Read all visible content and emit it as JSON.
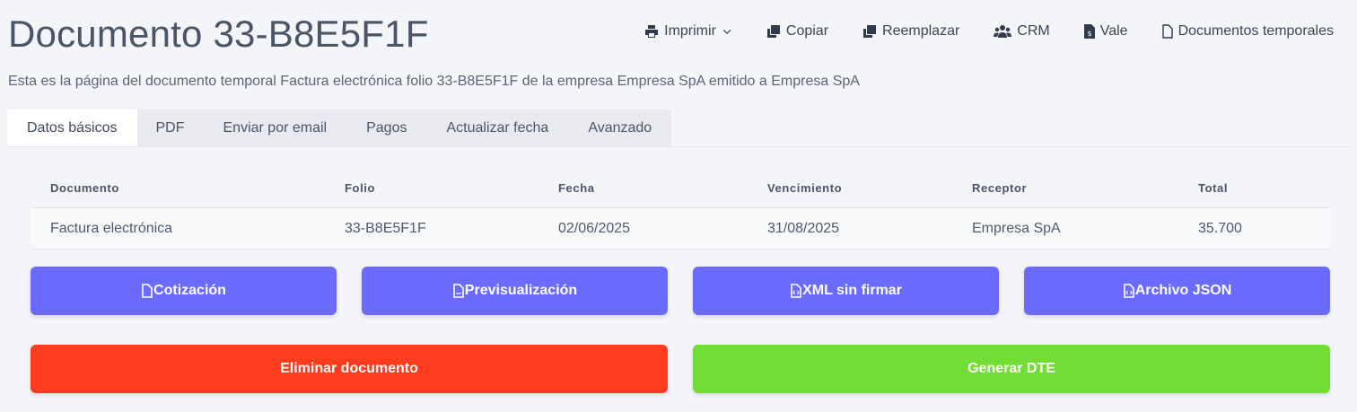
{
  "title": "Documento 33-B8E5F1F",
  "subtitle": "Esta es la página del documento temporal Factura electrónica folio 33-B8E5F1F de la empresa Empresa SpA emitido a Empresa SpA",
  "toolbar": {
    "imprimir": "Imprimir",
    "copiar": "Copiar",
    "reemplazar": "Reemplazar",
    "crm": "CRM",
    "vale": "Vale",
    "documentos": "Documentos temporales"
  },
  "tabs": [
    "Datos básicos",
    "PDF",
    "Enviar por email",
    "Pagos",
    "Actualizar fecha",
    "Avanzado"
  ],
  "table": {
    "headers": [
      "Documento",
      "Folio",
      "Fecha",
      "Vencimiento",
      "Receptor",
      "Total"
    ],
    "row": [
      "Factura electrónica",
      "33-B8E5F1F",
      "02/06/2025",
      "31/08/2025",
      "Empresa SpA",
      "35.700"
    ]
  },
  "buttons": {
    "cotizacion": "Cotización",
    "previsualizacion": "Previsualización",
    "xml": "XML sin firmar",
    "json": "Archivo JSON",
    "eliminar": "Eliminar documento",
    "generar": "Generar DTE"
  },
  "colors": {
    "primary": "#6b6cff",
    "danger": "#ff3c1e",
    "success": "#72dd34"
  }
}
